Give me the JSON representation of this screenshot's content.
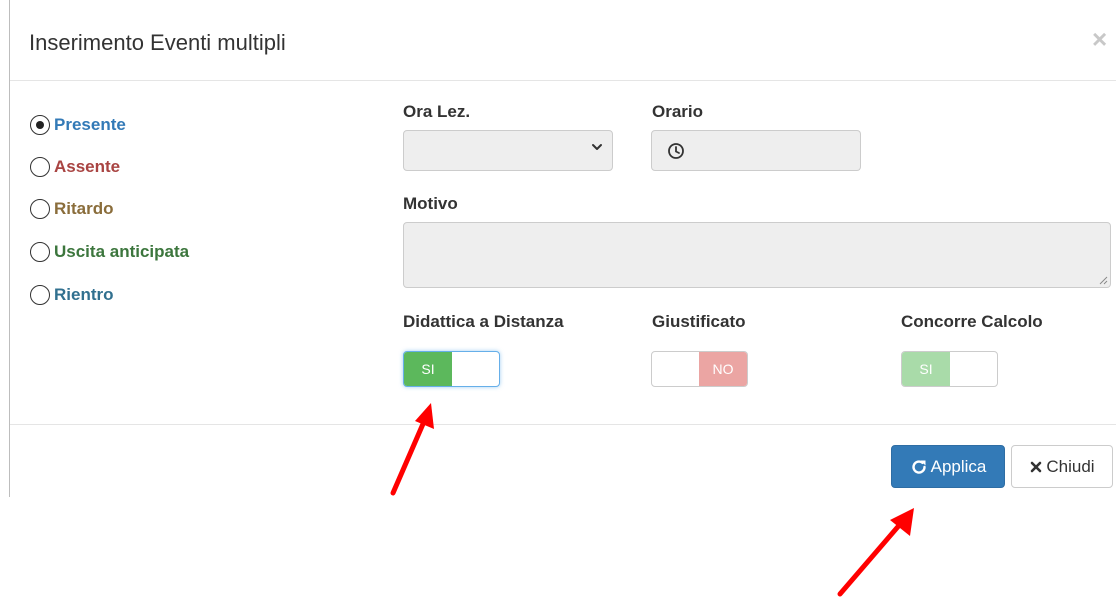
{
  "modal": {
    "title": "Inserimento Eventi multipli",
    "close_glyph": "×"
  },
  "event_types": [
    {
      "label": "Presente",
      "color": "#337ab7",
      "selected": true
    },
    {
      "label": "Assente",
      "color": "#a94442",
      "selected": false
    },
    {
      "label": "Ritardo",
      "color": "#8a6d3b",
      "selected": false
    },
    {
      "label": "Uscita anticipata",
      "color": "#3c763d",
      "selected": false
    },
    {
      "label": "Rientro",
      "color": "#31708f",
      "selected": false
    }
  ],
  "fields": {
    "ora_lez_label": "Ora Lez.",
    "orario_label": "Orario",
    "motivo_label": "Motivo",
    "ora_lez_value": "",
    "orario_value": "",
    "motivo_value": ""
  },
  "toggles": {
    "didattica": {
      "label": "Didattica a Distanza",
      "state_text": "SI",
      "on": true
    },
    "giustificato": {
      "label": "Giustificato",
      "state_text": "NO",
      "on": false
    },
    "concorre": {
      "label": "Concorre Calcolo",
      "state_text": "SI",
      "on": true
    }
  },
  "footer": {
    "apply_label": "Applica",
    "close_label": "Chiudi"
  },
  "icons": {
    "clock": "clock-icon",
    "chevron": "chevron-down-icon",
    "refresh": "redo-icon",
    "close": "times-icon"
  },
  "colors": {
    "primary": "#337ab7",
    "toggle_on": "#5cb85c",
    "toggle_on_disabled": "#a9dba9",
    "toggle_off_disabled": "#eba5a3",
    "annotation_arrow": "#ff0000"
  }
}
